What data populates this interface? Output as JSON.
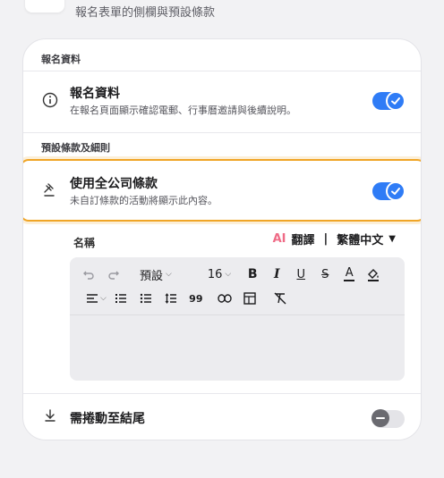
{
  "header": {
    "subtitle": "報名表單的側欄與預設條款"
  },
  "sections": {
    "registration": {
      "heading": "報名資料",
      "row": {
        "title": "報名資料",
        "desc": "在報名頁面顯示確認電郵、行事曆邀請與後續說明。",
        "icon": "info-icon",
        "toggle": "on"
      }
    },
    "terms": {
      "heading": "預設條款及細則",
      "row": {
        "title": "使用全公司條款",
        "desc": "未自訂條款的活動將顯示此內容。",
        "icon": "gavel-icon",
        "toggle": "on"
      }
    }
  },
  "editor": {
    "name_label": "名稱",
    "ai_label": "AI",
    "translate_label": "翻譯",
    "separator": "|",
    "language": "繁體中文",
    "toolbar": {
      "style_select": "預設",
      "size_select": "16"
    }
  },
  "scroll_row": {
    "title": "需捲動至結尾",
    "icon": "download-icon",
    "toggle": "off"
  },
  "colors": {
    "accent": "#2f7cf6",
    "highlight": "#f0a526",
    "ai": "#ef6b86"
  }
}
